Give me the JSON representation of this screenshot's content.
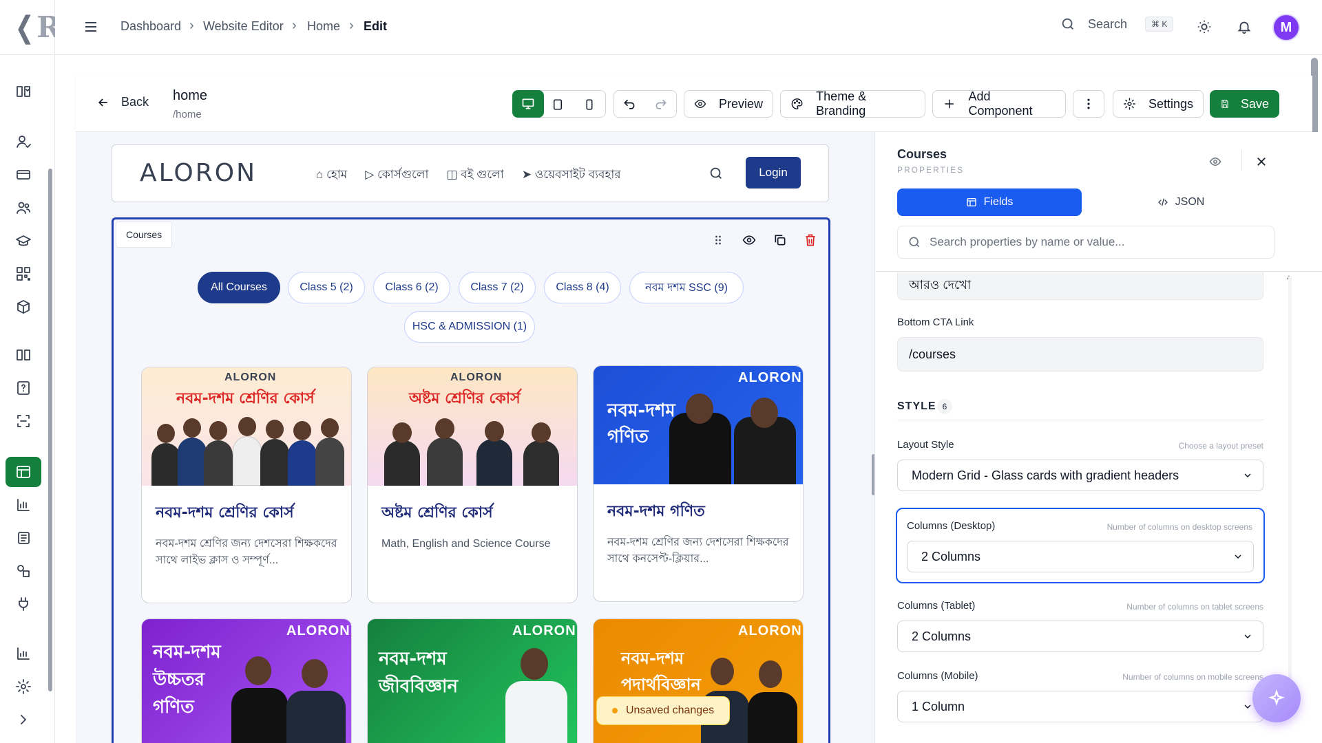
{
  "app": {
    "logo_text": "R"
  },
  "breadcrumb": [
    "Dashboard",
    "Website Editor",
    "Home",
    "Edit"
  ],
  "topbar": {
    "search_label": "Search",
    "search_shortcut": "⌘ K",
    "avatar_initial": "M"
  },
  "toolbar": {
    "back_label": "Back",
    "page_title": "home",
    "page_path": "/home",
    "preview_label": "Preview",
    "theme_label": "Theme & Branding",
    "add_component_label": "Add Component",
    "settings_label": "Settings",
    "save_label": "Save"
  },
  "site_header": {
    "brand": "ALORON",
    "nav": [
      "হোম",
      "কোর্সগুলো",
      "বই গুলো",
      "ওয়েবসাইট ব্যবহার"
    ],
    "login_label": "Login"
  },
  "section": {
    "tag": "Courses",
    "filters": [
      "All Courses",
      "Class 5 (2)",
      "Class 6 (2)",
      "Class 7 (2)",
      "Class 8 (4)",
      "নবম দশম SSC (9)",
      "HSC & ADMISSION (1)"
    ],
    "active_filter": "All Courses"
  },
  "courses": [
    {
      "banner": "নবম-দশম শ্রেণির কোর্স",
      "brand": "ALORON",
      "title": "নবম-দশম শ্রেণির কোর্স",
      "desc": "নবম-দশম শ্রেণির জন্য দেশসেরা শিক্ষকদের সাথে লাইভ ক্লাস ও সম্পূর্ণ..."
    },
    {
      "banner": "অষ্টম শ্রেণির কোর্স",
      "brand": "ALORON",
      "title": "অষ্টম শ্রেণির কোর্স",
      "desc": "Math, English and Science Course"
    },
    {
      "banner": "নবম-দশম গণিত",
      "brand": "ALORON",
      "title": "নবম-দশম গণিত",
      "desc": "নবম-দশম শ্রেণির জন্য দেশসেরা শিক্ষকদের সাথে কনসেপ্ট-ক্লিয়ার..."
    },
    {
      "banner": "নবম-দশম উচ্চতর গণিত",
      "brand": "ALORON"
    },
    {
      "banner": "নবম-দশম জীববিজ্ঞান",
      "brand": "ALORON"
    },
    {
      "banner": "নবম-দশম পদার্থবিজ্ঞান",
      "brand": "ALORON"
    }
  ],
  "unsaved_label": "Unsaved changes",
  "panel": {
    "title": "Courses",
    "subtitle": "PROPERTIES",
    "tab_fields": "Fields",
    "tab_json": "JSON",
    "search_placeholder": "Search properties by name or value...",
    "cta_text_value": "আরও দেখো",
    "cta_link_label": "Bottom CTA Link",
    "cta_link_value": "/courses",
    "style_heading": "STYLE",
    "style_count": "6",
    "layout_label": "Layout Style",
    "layout_hint": "Choose a layout preset",
    "layout_value": "Modern Grid - Glass cards with gradient headers",
    "col_desktop_label": "Columns (Desktop)",
    "col_desktop_hint": "Number of columns on desktop screens",
    "col_desktop_value": "2 Columns",
    "col_tablet_label": "Columns (Tablet)",
    "col_tablet_hint": "Number of columns on tablet screens",
    "col_tablet_value": "2 Columns",
    "col_mobile_label": "Columns (Mobile)",
    "col_mobile_hint": "Number of columns on mobile screens",
    "col_mobile_value": "1 Column"
  },
  "colors": {
    "accent_green": "#15803d",
    "accent_blue": "#1a5cf0",
    "navy": "#1e3a8a",
    "avatar": "#7e3af2"
  }
}
